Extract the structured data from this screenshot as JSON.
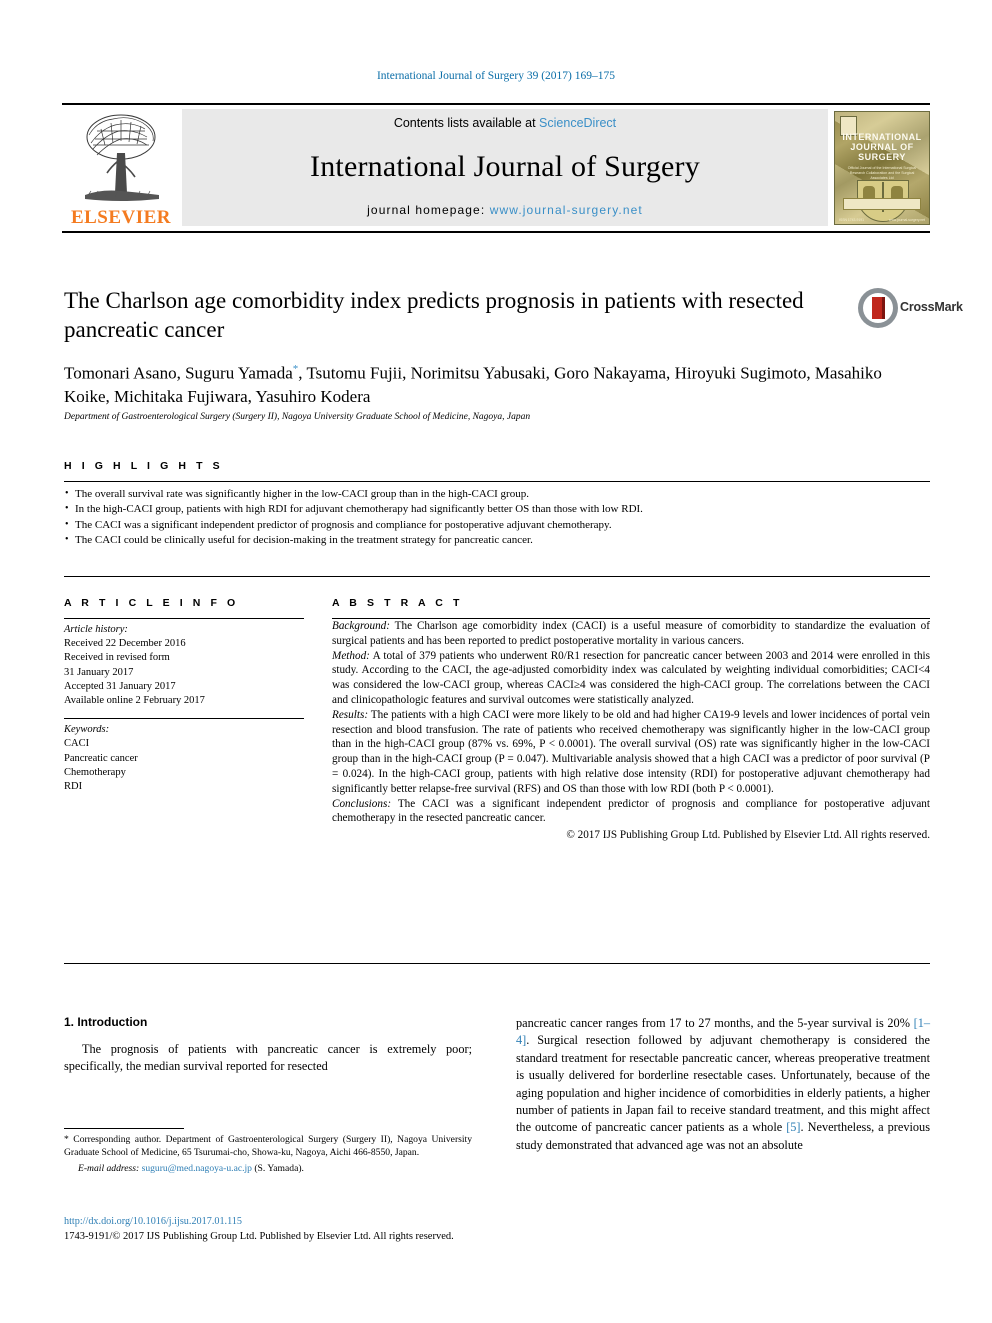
{
  "running_head": "International Journal of Surgery 39 (2017) 169–175",
  "masthead": {
    "publisher_name": "ELSEVIER",
    "contents_prefix": "Contents lists available at ",
    "contents_link": "ScienceDirect",
    "journal_title": "International Journal of Surgery",
    "homepage_label": "journal homepage: ",
    "homepage_url": "www.journal-surgery.net",
    "cover": {
      "title_line1": "INTERNATIONAL",
      "title_line2": "JOURNAL OF",
      "title_line3": "SURGERY",
      "subtitle": "Official Journal of the International Surgical Research Collaboration and the Surgical Associates Ltd",
      "foot_left": "ISSN 1743-9191",
      "foot_right": "www.journal-surgery.net"
    }
  },
  "article": {
    "title": "The Charlson age comorbidity index predicts prognosis in patients with resected pancreatic cancer",
    "crossmark_label": "CrossMark",
    "authors_line1": "Tomonari Asano, Suguru Yamada",
    "authors_marker": "*",
    "authors_line1_cont": ", Tsutomu Fujii, Norimitsu Yabusaki, Goro Nakayama,",
    "authors_line2": "Hiroyuki Sugimoto, Masahiko Koike, Michitaka Fujiwara, Yasuhiro Kodera",
    "affiliation": "Department of Gastroenterological Surgery (Surgery II), Nagoya University Graduate School of Medicine, Nagoya, Japan"
  },
  "highlights": {
    "heading": "H I G H L I G H T S",
    "items": [
      "The overall survival rate was significantly higher in the low-CACI group than in the high-CACI group.",
      "In the high-CACI group, patients with high RDI for adjuvant chemotherapy had significantly better OS than those with low RDI.",
      "The CACI was a significant independent predictor of prognosis and compliance for postoperative adjuvant chemotherapy.",
      "The CACI could be clinically useful for decision-making in the treatment strategy for pancreatic cancer."
    ]
  },
  "article_info": {
    "heading": "A R T I C L E   I N F O",
    "history_label": "Article history:",
    "history_lines": [
      "Received 22 December 2016",
      "Received in revised form",
      "31 January 2017",
      "Accepted 31 January 2017",
      "Available online 2 February 2017"
    ],
    "keywords_label": "Keywords:",
    "keywords": [
      "CACI",
      "Pancreatic cancer",
      "Chemotherapy",
      "RDI"
    ]
  },
  "abstract": {
    "heading": "A B S T R A C T",
    "background_label": "Background:",
    "background_text": " The Charlson age comorbidity index (CACI) is a useful measure of comorbidity to standardize the evaluation of surgical patients and has been reported to predict postoperative mortality in various cancers.",
    "method_label": "Method:",
    "method_text": " A total of 379 patients who underwent R0/R1 resection for pancreatic cancer between 2003 and 2014 were enrolled in this study. According to the CACI, the age-adjusted comorbidity index was calculated by weighting individual comorbidities; CACI<4 was considered the low-CACI group, whereas CACI≥4 was considered the high-CACI group. The correlations between the CACI and clinicopathologic features and survival outcomes were statistically analyzed.",
    "results_label": "Results:",
    "results_text": " The patients with a high CACI were more likely to be old and had higher CA19-9 levels and lower incidences of portal vein resection and blood transfusion. The rate of patients who received chemotherapy was significantly higher in the low-CACI group than in the high-CACI group (87% vs. 69%, P < 0.0001). The overall survival (OS) rate was significantly higher in the low-CACI group than in the high-CACI group (P = 0.047). Multivariable analysis showed that a high CACI was a predictor of poor survival (P = 0.024). In the high-CACI group, patients with high relative dose intensity (RDI) for postoperative adjuvant chemotherapy had significantly better relapse-free survival (RFS) and OS than those with low RDI (both P < 0.0001).",
    "conclusions_label": "Conclusions:",
    "conclusions_text": " The CACI was a significant independent predictor of prognosis and compliance for postoperative adjuvant chemotherapy in the resected pancreatic cancer.",
    "copyright": "© 2017 IJS Publishing Group Ltd. Published by Elsevier Ltd. All rights reserved."
  },
  "body": {
    "section_heading": "1. Introduction",
    "left_paragraph": "The prognosis of patients with pancreatic cancer is extremely poor; specifically, the median survival reported for resected",
    "right_paragraph_part1": "pancreatic cancer ranges from 17 to 27 months, and the 5-year survival is 20% ",
    "right_ref1": "[1–4]",
    "right_paragraph_part2": ". Surgical resection followed by adjuvant chemotherapy is considered the standard treatment for resectable pancreatic cancer, whereas preoperative treatment is usually delivered for borderline resectable cases. Unfortunately, because of the aging population and higher incidence of comorbidities in elderly patients, a higher number of patients in Japan fail to receive standard treatment, and this might affect the outcome of pancreatic cancer patients as a whole ",
    "right_ref2": "[5]",
    "right_paragraph_part3": ". Nevertheless, a previous study demonstrated that advanced age was not an absolute"
  },
  "footnote": {
    "corresponding": "* Corresponding author. Department of Gastroenterological Surgery (Surgery II), Nagoya University Graduate School of Medicine, 65 Tsurumai-cho, Showa-ku, Nagoya, Aichi 466-8550, Japan.",
    "email_label": "E-mail address:",
    "email": "suguru@med.nagoya-u.ac.jp",
    "email_suffix": " (S. Yamada)."
  },
  "footer": {
    "doi": "http://dx.doi.org/10.1016/j.ijsu.2017.01.115",
    "issn_line": "1743-9191/© 2017 IJS Publishing Group Ltd. Published by Elsevier Ltd. All rights reserved."
  },
  "colors": {
    "link": "#2f7fb5",
    "elsevier_orange": "#F47B20",
    "band_gray": "#e9e9e9"
  }
}
